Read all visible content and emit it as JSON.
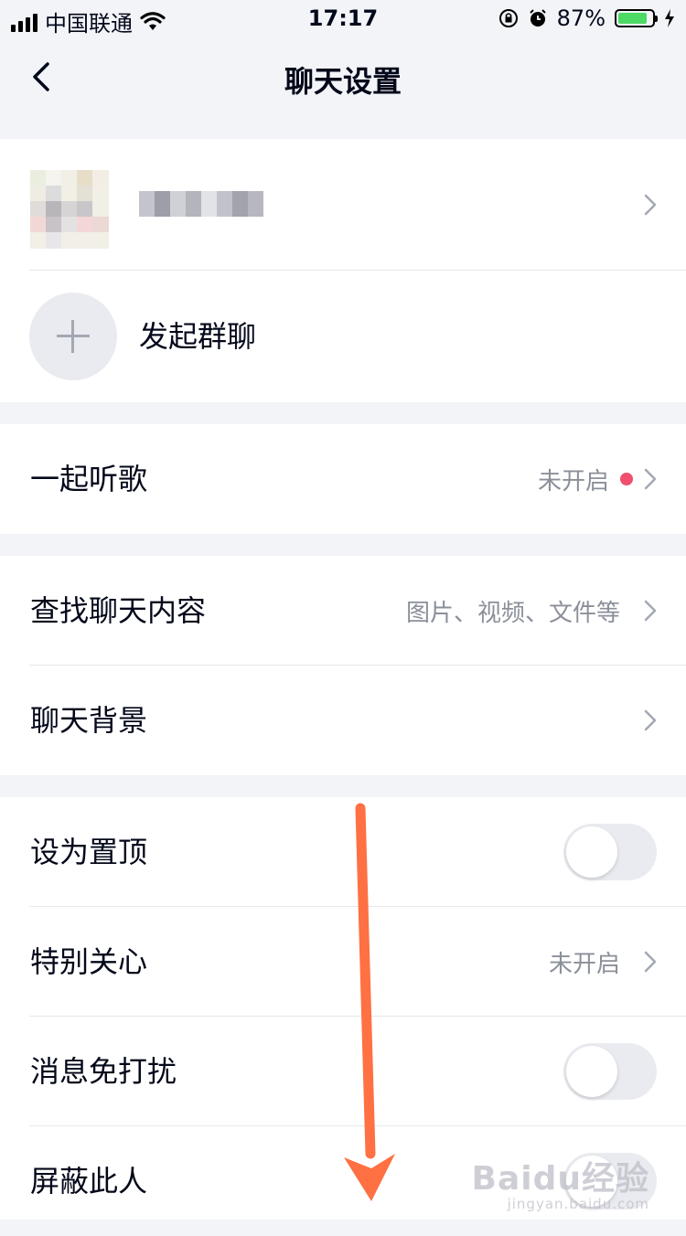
{
  "status_bar": {
    "carrier": "中国联通",
    "time": "17:17",
    "battery_percent": "87%",
    "battery_level": 0.87,
    "icons": [
      "signal-icon",
      "wifi-icon",
      "rotation-lock-icon",
      "alarm-icon",
      "battery-icon",
      "charging-icon"
    ]
  },
  "nav": {
    "title": "聊天设置",
    "back_icon": "chevron-left-icon"
  },
  "profile": {
    "start_group_label": "发起群聊"
  },
  "section_music": {
    "listen_together_label": "一起听歌",
    "listen_together_status": "未开启"
  },
  "section_content": {
    "search_label": "查找聊天内容",
    "search_hint": "图片、视频、文件等",
    "background_label": "聊天背景"
  },
  "section_settings": {
    "pin_label": "设为置顶",
    "pin_on": false,
    "special_care_label": "特别关心",
    "special_care_status": "未开启",
    "dnd_label": "消息免打扰",
    "dnd_on": false,
    "block_label": "屏蔽此人",
    "block_on": false
  },
  "watermark": {
    "logo": "Baidu经验",
    "site": "jingyan.baidu.com"
  },
  "colors": {
    "accent_red": "#f0506e",
    "annotation_arrow": "#ff7043",
    "battery_green": "#4cd964"
  }
}
